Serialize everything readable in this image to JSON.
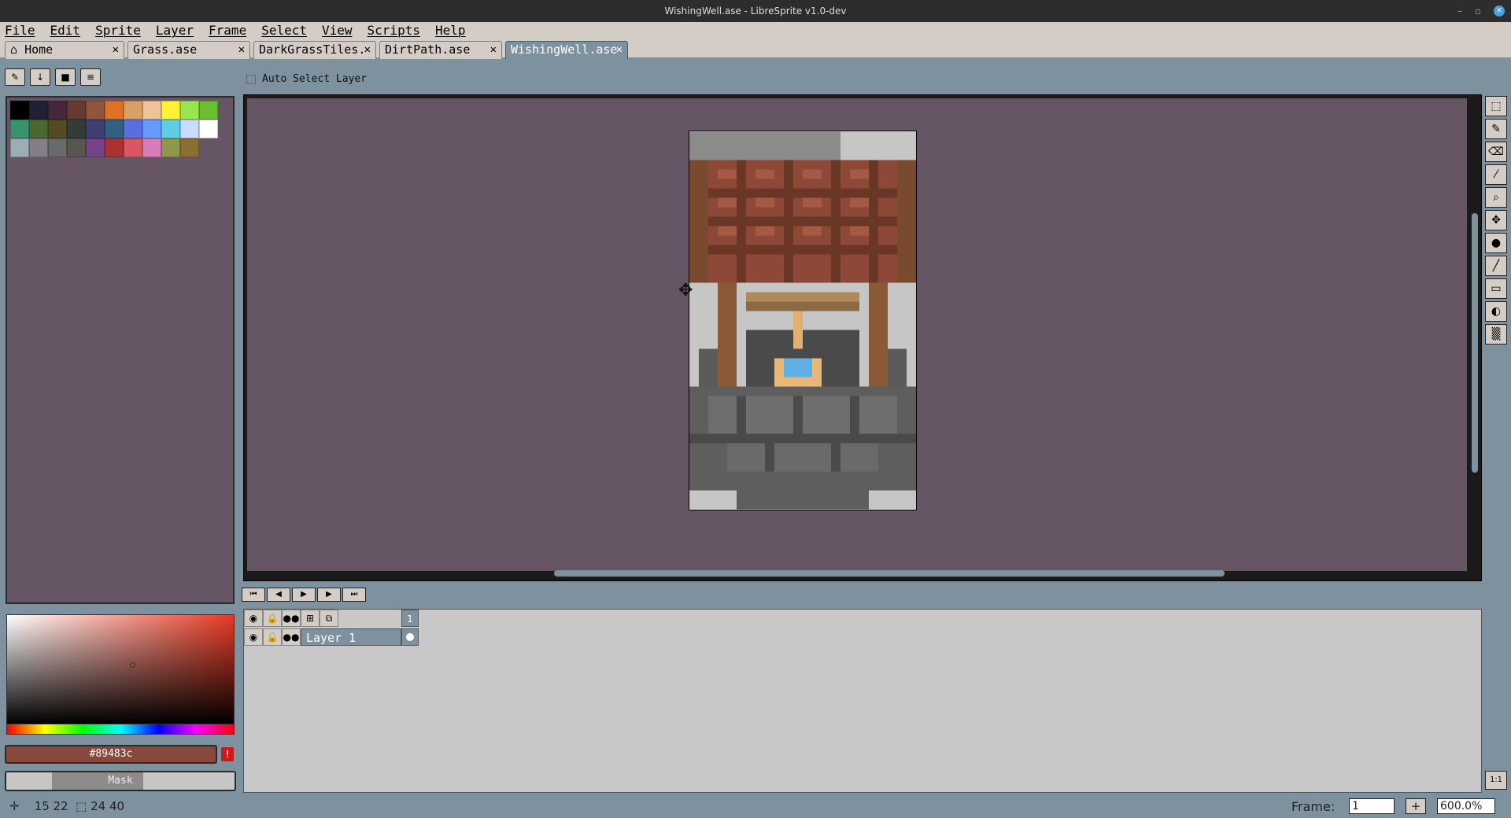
{
  "window": {
    "title": "WishingWell.ase - LibreSprite v1.0-dev"
  },
  "menu": [
    "File",
    "Edit",
    "Sprite",
    "Layer",
    "Frame",
    "Select",
    "View",
    "Scripts",
    "Help"
  ],
  "tabs": [
    {
      "label": "Home"
    },
    {
      "label": "Grass.ase"
    },
    {
      "label": "DarkGrassTiles."
    },
    {
      "label": "DirtPath.ase"
    },
    {
      "label": "WishingWell.ase"
    }
  ],
  "options": {
    "auto_select_layer": "Auto Select Layer"
  },
  "palette": [
    "#000000",
    "#222034",
    "#45283c",
    "#663931",
    "#8f563b",
    "#df7126",
    "#d9a066",
    "#eec39a",
    "#fbf236",
    "#99e550",
    "#6abe30",
    "#37946e",
    "#4b692f",
    "#524b24",
    "#323c39",
    "#3f3f74",
    "#306082",
    "#5b6ee1",
    "#639bff",
    "#5fcde4",
    "#cbdbfc",
    "#ffffff",
    "#9badb7",
    "#847e87",
    "#696a6a",
    "#595652",
    "#76428a",
    "#ac3232",
    "#d95763",
    "#d77bba",
    "#8f974a",
    "#8a6f30"
  ],
  "color": {
    "hex": "#89483c",
    "mask_label": "Mask"
  },
  "layers": {
    "frame_number": "1",
    "layer_name": "Layer 1"
  },
  "status": {
    "coords": "15 22",
    "size": "24 40"
  },
  "frame": {
    "label": "Frame:",
    "value": "1",
    "zoom": "600.0%"
  }
}
